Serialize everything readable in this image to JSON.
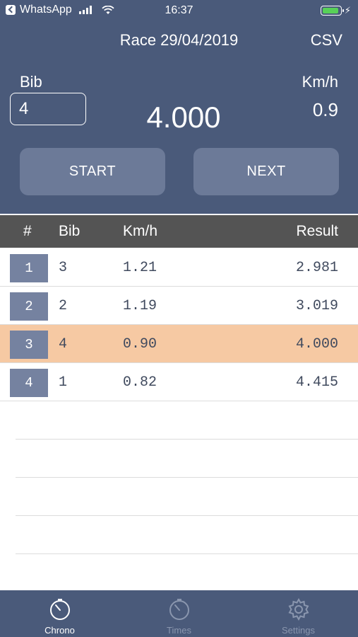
{
  "status_bar": {
    "back_app": "WhatsApp",
    "time": "16:37"
  },
  "nav": {
    "title": "Race 29/04/2019",
    "action": "CSV"
  },
  "chrono": {
    "bib_label": "Bib",
    "bib_value": "4",
    "time": "4.000",
    "kmh_label": "Km/h",
    "kmh_value": "0.9",
    "start_label": "START",
    "next_label": "NEXT"
  },
  "table": {
    "columns": [
      "#",
      "Bib",
      "Km/h",
      "Result"
    ],
    "rows": [
      {
        "num": "1",
        "bib": "3",
        "kmh": "1.21",
        "result": "2.981"
      },
      {
        "num": "2",
        "bib": "2",
        "kmh": "1.19",
        "result": "3.019"
      },
      {
        "num": "3",
        "bib": "4",
        "kmh": "0.90",
        "result": "4.000"
      },
      {
        "num": "4",
        "bib": "1",
        "kmh": "0.82",
        "result": "4.415"
      }
    ]
  },
  "tabs": [
    {
      "label": "Chrono",
      "icon": "stopwatch-icon"
    },
    {
      "label": "Times",
      "icon": "stopwatch-icon"
    },
    {
      "label": "Settings",
      "icon": "gear-icon"
    }
  ],
  "colors": {
    "header_bg": "#4a5a7a",
    "button_bg": "#6c7a98",
    "index_bg": "#7582a0",
    "highlight_row": "#f6c9a3",
    "table_header_bg": "#545454"
  }
}
